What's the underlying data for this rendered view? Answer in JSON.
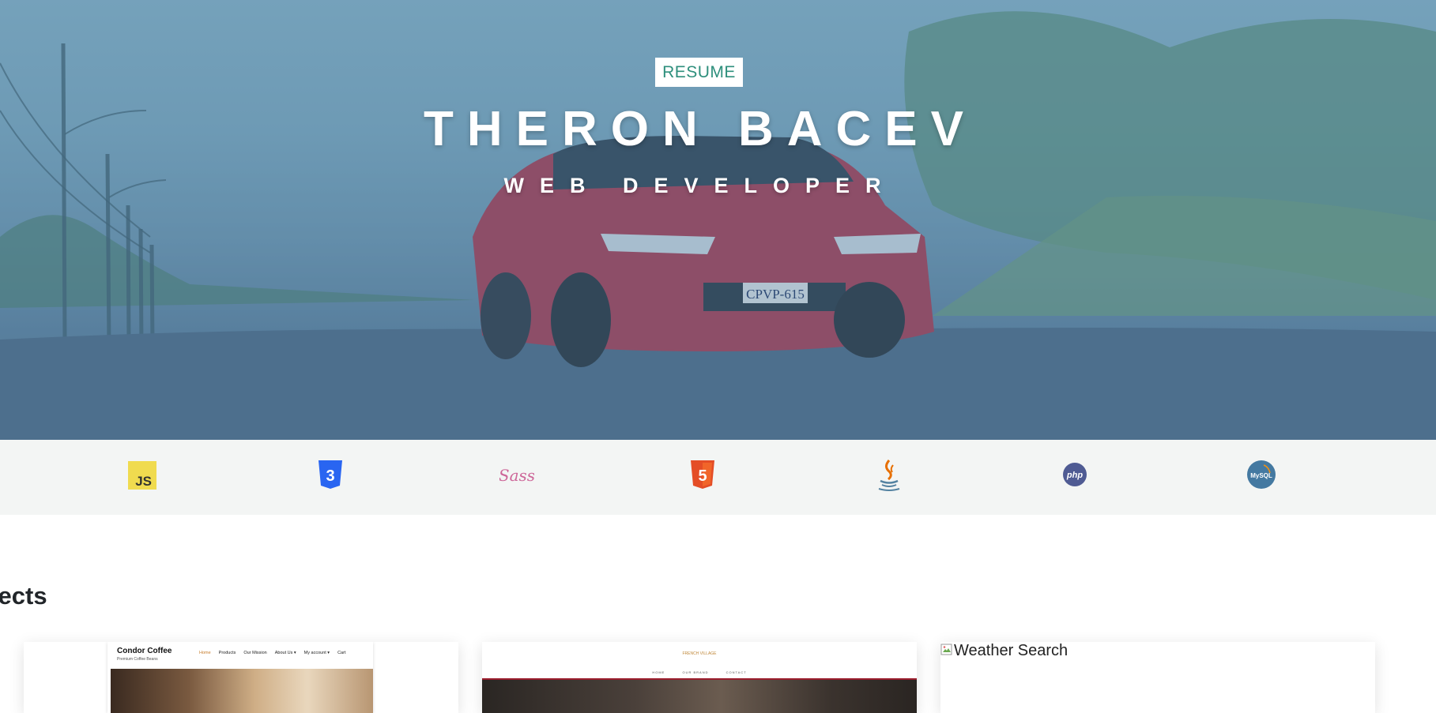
{
  "hero": {
    "resume_label": "RESUME",
    "name": "THERON BACEV",
    "role": "WEB DEVELOPER",
    "plate": "CPVP-615"
  },
  "skills": [
    {
      "name": "javascript-icon",
      "text": "JS",
      "color": "#f0db4f"
    },
    {
      "name": "css3-icon",
      "text": "3",
      "color": "#2965f1"
    },
    {
      "name": "sass-icon",
      "text": "Sass",
      "color": "#cd6799"
    },
    {
      "name": "html5-icon",
      "text": "5",
      "color": "#e44d26"
    },
    {
      "name": "java-icon",
      "color": "#e76f00"
    },
    {
      "name": "php-icon",
      "text": "php",
      "color": "#4f5b93"
    },
    {
      "name": "mysql-icon",
      "text": "MySQL",
      "color": "#4479a1"
    }
  ],
  "projects": {
    "heading": "ojects",
    "cards": [
      {
        "brand": "Condor Coffee",
        "tagline": "Premium Coffee Beans",
        "nav": [
          "Home",
          "Products",
          "Our Mission",
          "About Us ▾",
          "My account ▾",
          "Cart"
        ]
      },
      {
        "logo": "FRENCH VILLAGE",
        "nav": [
          "HOME",
          "OUR BRAND",
          "CONTACT"
        ]
      },
      {
        "alt": "Weather Search"
      }
    ]
  }
}
